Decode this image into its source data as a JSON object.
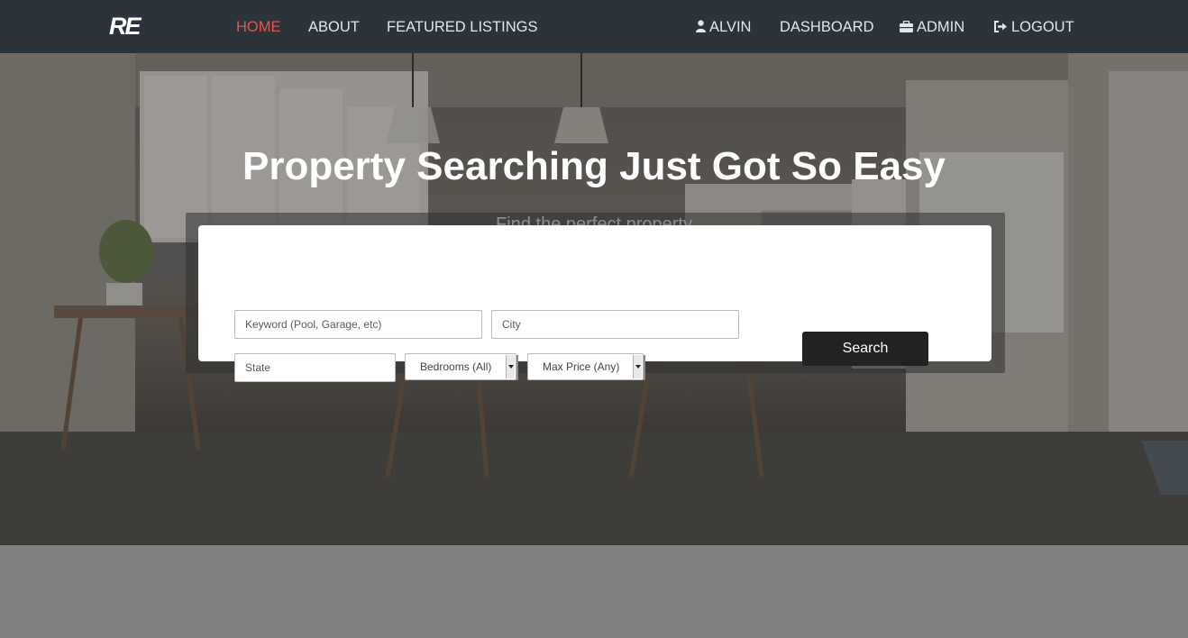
{
  "nav": {
    "logo": "RE",
    "home": "HOME",
    "about": "ABOUT",
    "featured": "FEATURED LISTINGS",
    "user": "ALVIN",
    "dashboard": "DASHBOARD",
    "admin": "ADMIN",
    "logout": "LOGOUT",
    "active_color": "#e0584f"
  },
  "hero": {
    "title": "Property Searching Just Got So Easy",
    "subtitle": "Find the perfect property"
  },
  "search": {
    "keyword_placeholder": "Keyword (Pool, Garage, etc)",
    "city_placeholder": "City",
    "state_placeholder": "State",
    "bedrooms_selected": "Bedrooms (All)",
    "max_price_selected": "Max Price (Any)",
    "button_label": "Search"
  },
  "icons": {
    "user": "user-icon",
    "admin": "briefcase-icon",
    "logout": "sign-out-icon"
  }
}
